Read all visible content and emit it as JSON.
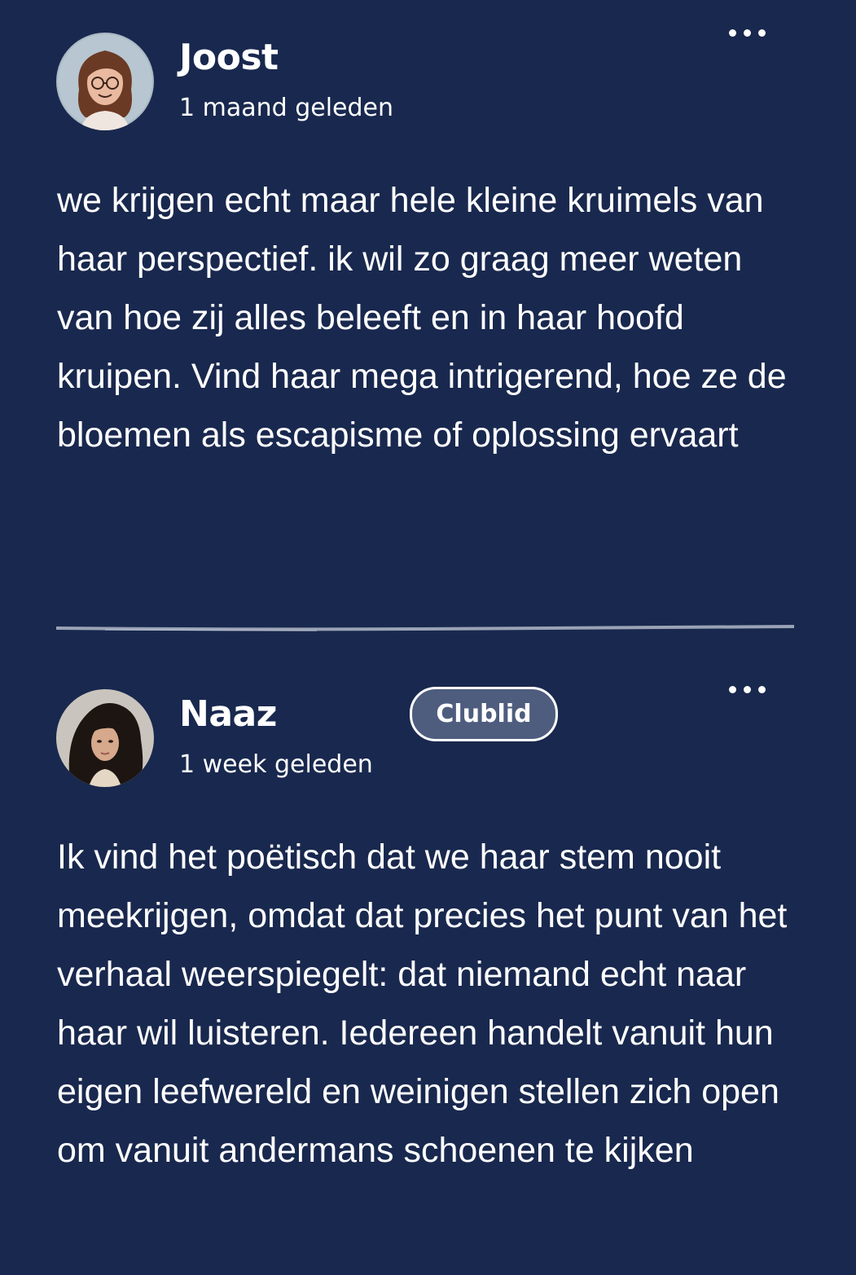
{
  "comments": [
    {
      "author": "Joost",
      "timestamp": "1 maand geleden",
      "text": "we krijgen echt maar hele kleine kruimels van haar perspectief. ik wil zo graag meer weten van hoe zij alles beleeft en in haar hoofd kruipen. Vind haar mega intrigerend, hoe ze de bloemen als escapisme of oplossing ervaart",
      "avatar_icon": "cartoon-avatar-icon",
      "more_icon": "more-dots-icon"
    },
    {
      "author": "Naaz",
      "badge": "Clublid",
      "timestamp": "1 week geleden",
      "text": "Ik vind het poëtisch dat we haar stem nooit meekrijgen, omdat dat precies het punt van het verhaal weerspiegelt: dat niemand echt naar haar wil luisteren. Iedereen handelt vanuit hun eigen leefwereld en weinigen stellen zich open om vanuit andermans schoenen te kijken",
      "avatar_icon": "photo-avatar-icon",
      "more_icon": "more-dots-icon"
    }
  ],
  "colors": {
    "background": "#19284e",
    "text": "#ffffff",
    "badge_bg": "#4e5d7e",
    "divider": "#9aa3b6"
  }
}
